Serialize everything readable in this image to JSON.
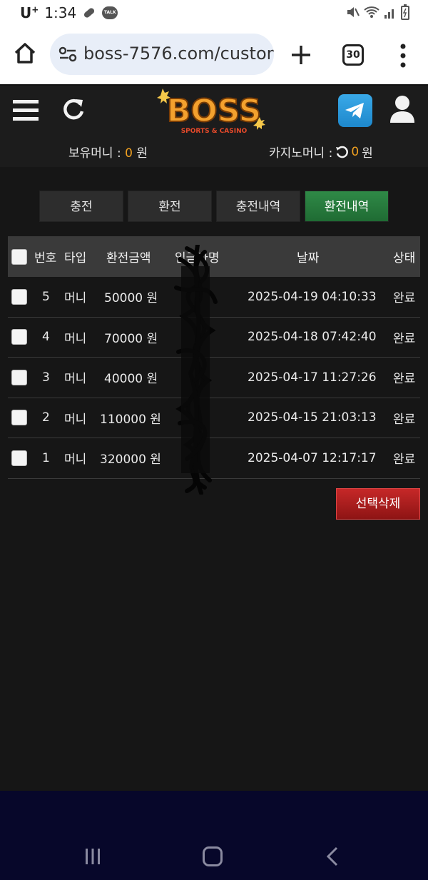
{
  "status": {
    "carrier": "U",
    "carrier_sup": "+",
    "time": "1:34",
    "talk_badge": "TALK"
  },
  "browser": {
    "url": "boss-7576.com/custom",
    "tab_count": "30"
  },
  "site": {
    "logo_text": "BOSS",
    "logo_sub": "SPORTS & CASINO",
    "balance_label": "보유머니 :",
    "balance_value": "0",
    "balance_unit": "원",
    "casino_label": "카지노머니 :",
    "casino_value": "0",
    "casino_unit": "원"
  },
  "tabs": [
    {
      "label": "충전",
      "active": false
    },
    {
      "label": "환전",
      "active": false
    },
    {
      "label": "충전내역",
      "active": false
    },
    {
      "label": "환전내역",
      "active": true
    }
  ],
  "table": {
    "headers": [
      "번호",
      "타입",
      "환전금액",
      "입금자명",
      "날짜",
      "상태"
    ],
    "rows": [
      {
        "no": "5",
        "type": "머니",
        "amount": "50000 원",
        "date": "2025-04-19 04:10:33",
        "status": "완료"
      },
      {
        "no": "4",
        "type": "머니",
        "amount": "70000 원",
        "date": "2025-04-18 07:42:40",
        "status": "완료"
      },
      {
        "no": "3",
        "type": "머니",
        "amount": "40000 원",
        "date": "2025-04-17 11:27:26",
        "status": "완료"
      },
      {
        "no": "2",
        "type": "머니",
        "amount": "110000 원",
        "date": "2025-04-15 21:03:13",
        "status": "완료"
      },
      {
        "no": "1",
        "type": "머니",
        "amount": "320000 원",
        "date": "2025-04-07 12:17:17",
        "status": "완료"
      }
    ]
  },
  "actions": {
    "delete_selected": "선택삭제"
  },
  "colors": {
    "accent": "#f0a020",
    "active_tab": "#2f8a47",
    "delete": "#c62828"
  }
}
